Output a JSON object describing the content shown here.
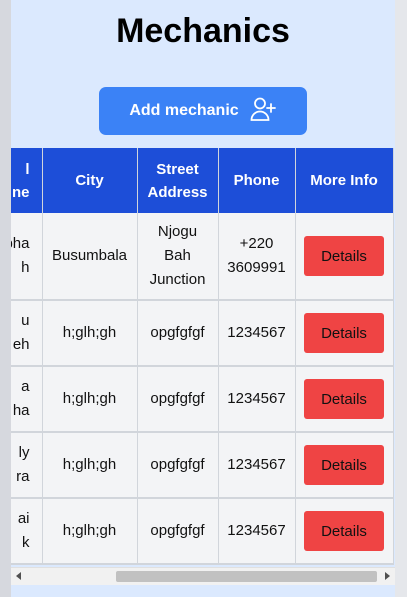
{
  "page": {
    "title": "Mechanics"
  },
  "add_button": {
    "label": "Add mechanic",
    "icon": "user-plus-icon"
  },
  "table": {
    "headers": {
      "name_partial": [
        "l",
        "ne"
      ],
      "city": "City",
      "street_address": [
        "Street",
        "Address"
      ],
      "phone": "Phone",
      "more_info": "More Info"
    },
    "rows": [
      {
        "name": [
          "pha",
          "h"
        ],
        "city": "Busumbala",
        "street": [
          "Njogu",
          "Bah",
          "Junction"
        ],
        "phone": [
          "+220",
          "3609991"
        ],
        "action": "Details"
      },
      {
        "name": [
          "u",
          "eh"
        ],
        "city": "h;glh;gh",
        "street": [
          "opgfgfgf"
        ],
        "phone": [
          "1234567"
        ],
        "action": "Details"
      },
      {
        "name": [
          "a",
          "ha"
        ],
        "city": "h;glh;gh",
        "street": [
          "opgfgfgf"
        ],
        "phone": [
          "1234567"
        ],
        "action": "Details"
      },
      {
        "name": [
          "ly",
          "ra"
        ],
        "city": "h;glh;gh",
        "street": [
          "opgfgfgf"
        ],
        "phone": [
          "1234567"
        ],
        "action": "Details"
      },
      {
        "name": [
          "ai",
          "k"
        ],
        "city": "h;glh;gh",
        "street": [
          "opgfgfgf"
        ],
        "phone": [
          "1234567"
        ],
        "action": "Details"
      }
    ]
  },
  "colors": {
    "page_bg": "#dbe9fe",
    "header_bg": "#1d4ed8",
    "add_button_bg": "#3b82f6",
    "details_button_bg": "#ef4444"
  }
}
